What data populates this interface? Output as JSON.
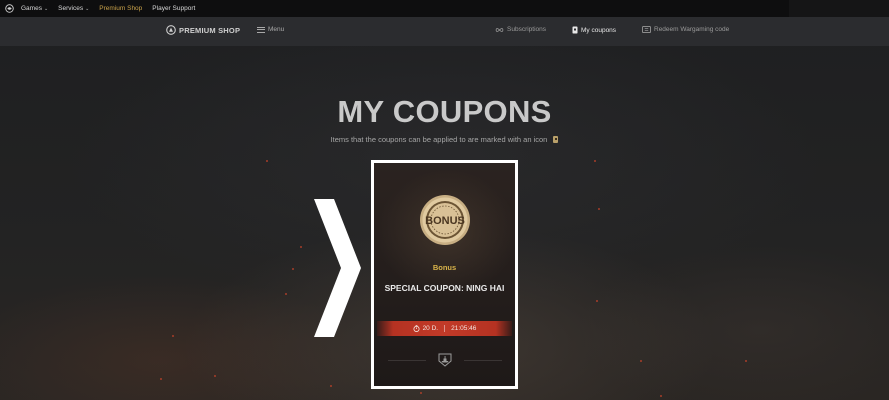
{
  "topbar": {
    "items": [
      {
        "label": "Games",
        "has_dropdown": true
      },
      {
        "label": "Services",
        "has_dropdown": true
      },
      {
        "label": "Premium Shop",
        "has_dropdown": false,
        "active": true
      },
      {
        "label": "Player Support",
        "has_dropdown": false
      }
    ],
    "chevron_glyph": "⌄"
  },
  "navbar": {
    "brand": "PREMIUM SHOP",
    "menu_label": "Menu",
    "links": [
      {
        "label": "Subscriptions",
        "icon": "infinity-icon"
      },
      {
        "label": "My coupons",
        "icon": "coupon-icon",
        "active": true
      },
      {
        "label": "Redeem Wargaming code",
        "icon": "ticket-icon"
      }
    ]
  },
  "page": {
    "title": "MY COUPONS",
    "subtitle": "Items that the coupons can be applied to are marked with an icon"
  },
  "coupon": {
    "badge_text": "BONUS",
    "type": "Bonus",
    "name": "SPECIAL COUPON: NING HAI",
    "timer_days": "20 D.",
    "timer_time": "21:05:46",
    "footer_icon": "warship-emblem-icon"
  },
  "colors": {
    "accent_gold": "#c9a24a",
    "timer_red": "#c23a28",
    "card_border": "#ffffff",
    "background": "#1c1d1f"
  }
}
